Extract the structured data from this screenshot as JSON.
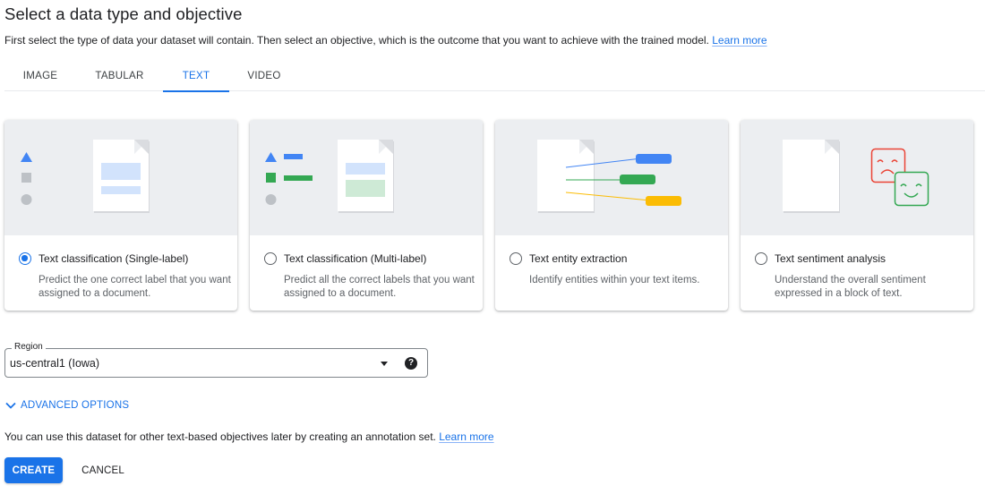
{
  "header": {
    "title": "Select a data type and objective",
    "subtitle": "First select the type of data your dataset will contain. Then select an objective, which is the outcome that you want to achieve with the trained model.",
    "learn_more": "Learn more"
  },
  "tabs": [
    {
      "label": "IMAGE",
      "active": false
    },
    {
      "label": "TABULAR",
      "active": false
    },
    {
      "label": "TEXT",
      "active": true
    },
    {
      "label": "VIDEO",
      "active": false
    }
  ],
  "objectives": [
    {
      "title": "Text classification (Single-label)",
      "description": "Predict the one correct label that you want assigned to a document.",
      "selected": true
    },
    {
      "title": "Text classification (Multi-label)",
      "description": "Predict all the correct labels that you want assigned to a document.",
      "selected": false
    },
    {
      "title": "Text entity extraction",
      "description": "Identify entities within your text items.",
      "selected": false
    },
    {
      "title": "Text sentiment analysis",
      "description": "Understand the overall sentiment expressed in a block of text.",
      "selected": false
    }
  ],
  "region": {
    "label": "Region",
    "value": "us-central1 (Iowa)",
    "help_icon": "?"
  },
  "advanced_options": {
    "label": "ADVANCED OPTIONS",
    "icon": "chevron-down-icon"
  },
  "footnote": {
    "text": "You can use this dataset for other text-based objectives later by creating an annotation set.",
    "learn_more": "Learn more"
  },
  "actions": {
    "create_label": "CREATE",
    "cancel_label": "CANCEL"
  },
  "colors": {
    "accent": "#1a73e8",
    "blue": "#4285f4",
    "green": "#34a853",
    "yellow": "#fbbc04",
    "red": "#ea4335",
    "illustration_bg": "#eceef1"
  }
}
